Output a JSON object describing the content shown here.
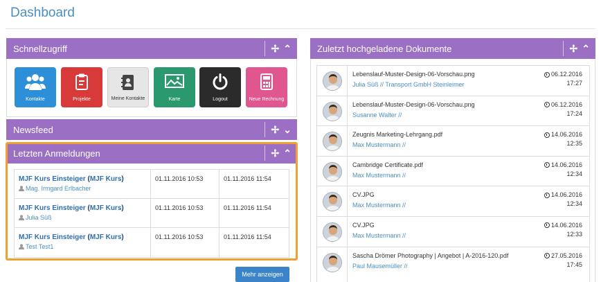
{
  "page": {
    "title": "Dashboard"
  },
  "colors": {
    "panel_header": "#9b6fc3",
    "link": "#4a8fc4",
    "button": "#3b84c9",
    "highlight": "#f0a030"
  },
  "schnellzugriff": {
    "title": "Schnellzugriff",
    "controls": {
      "move": "✢",
      "collapse": "⌃"
    },
    "tiles": [
      {
        "label": "Kontakte",
        "icon": "users-icon",
        "color": "#2e8fd9"
      },
      {
        "label": "Projekte",
        "icon": "clipboard-icon",
        "color": "#d83a3a"
      },
      {
        "label": "Meine Kontakte",
        "icon": "address-book-icon",
        "color": "#e6e6e6"
      },
      {
        "label": "Karte",
        "icon": "map-icon",
        "color": "#2a9a6e"
      },
      {
        "label": "Logout",
        "icon": "power-icon",
        "color": "#2b2b2b"
      },
      {
        "label": "Neue Rechnung",
        "icon": "calculator-icon",
        "color": "#e0568f"
      }
    ]
  },
  "newsfeed": {
    "title": "Newsfeed",
    "controls": {
      "move": "✢",
      "expand": "⌄"
    }
  },
  "logins": {
    "title": "Letzten Anmeldungen",
    "controls": {
      "move": "✢",
      "collapse": "⌃"
    },
    "rows": [
      {
        "course_name": "MJF Kurs Einsteiger",
        "course_tag": "MJF Kurs",
        "user": "Mag. Irmgard Erlbacher",
        "start": "01.11.2016 10:53",
        "end": "01.11.2016 11:54"
      },
      {
        "course_name": "MJF Kurs Einsteiger",
        "course_tag": "MJF Kurs",
        "user": "Julia Süß",
        "start": "01.11.2016 10:53",
        "end": "01.11.2016 11:54"
      },
      {
        "course_name": "MJF Kurs Einsteiger",
        "course_tag": "MJF Kurs",
        "user": "Test Test1",
        "start": "01.11.2016 10:53",
        "end": "01.11.2016 11:54"
      }
    ],
    "more_button": "Mehr anzeigen"
  },
  "documents": {
    "title": "Zuletzt hochgeladene Dokumente",
    "controls": {
      "move": "✢",
      "collapse": "⌃"
    },
    "rows": [
      {
        "file": "Lebenslauf-Muster-Design-06-Vorschau.png",
        "owner": "Julia Süß // Transport GmbH Steinleimer",
        "date": "06.12.2016",
        "time": "17:27"
      },
      {
        "file": "Lebenslauf-Muster-Design-06-Vorschau.png",
        "owner": "Susanne Walter //",
        "date": "06.12.2016",
        "time": "17:24"
      },
      {
        "file": "Zeugnis Marketing-Lehrgang.pdf",
        "owner": "Max Mustermann //",
        "date": "14.06.2016",
        "time": "12:35"
      },
      {
        "file": "Cambridge Certificate.pdf",
        "owner": "Max Mustermann //",
        "date": "14.06.2016",
        "time": "12:34"
      },
      {
        "file": "CV.JPG",
        "owner": "Max Mustermann //",
        "date": "14.06.2016",
        "time": "12:34"
      },
      {
        "file": "CV.JPG",
        "owner": "Max Mustermann //",
        "date": "14.06.2016",
        "time": "12:33"
      },
      {
        "file": "Sascha Drömer Photography | Angebot | A-2016-120.pdf",
        "owner": "Paul Mausemüller //",
        "date": "27.05.2016",
        "time": "17:45"
      }
    ]
  }
}
